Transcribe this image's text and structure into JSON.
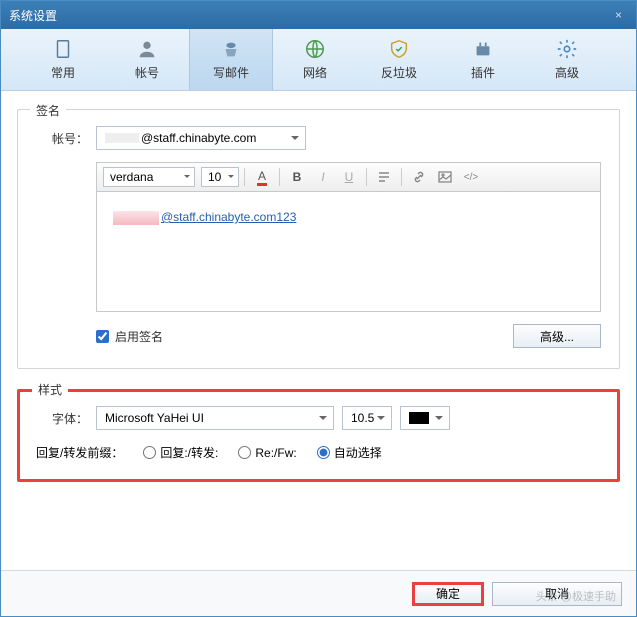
{
  "window": {
    "title": "系统设置"
  },
  "tabs": {
    "common": "常用",
    "account": "帐号",
    "compose": "写邮件",
    "network": "网络",
    "antispam": "反垃圾",
    "plugin": "插件",
    "advanced": "高级"
  },
  "signature": {
    "legend": "签名",
    "account_label": "帐号：",
    "account_value": "@staff.chinabyte.com",
    "font_family": "verdana",
    "font_size": "10",
    "body_text": "@staff.chinabyte.com123",
    "enable_label": "启用签名",
    "advanced_btn": "高级..."
  },
  "style": {
    "legend": "样式",
    "font_label": "字体：",
    "font_value": "Microsoft YaHei UI",
    "font_size": "10.5",
    "prefix_label": "回复/转发前缀：",
    "opt_reply": "回复:/转发:",
    "opt_refw": "Re:/Fw:",
    "opt_auto": "自动选择"
  },
  "footer": {
    "ok": "确定",
    "cancel": "取消",
    "watermark": "头条 @极速手助"
  }
}
